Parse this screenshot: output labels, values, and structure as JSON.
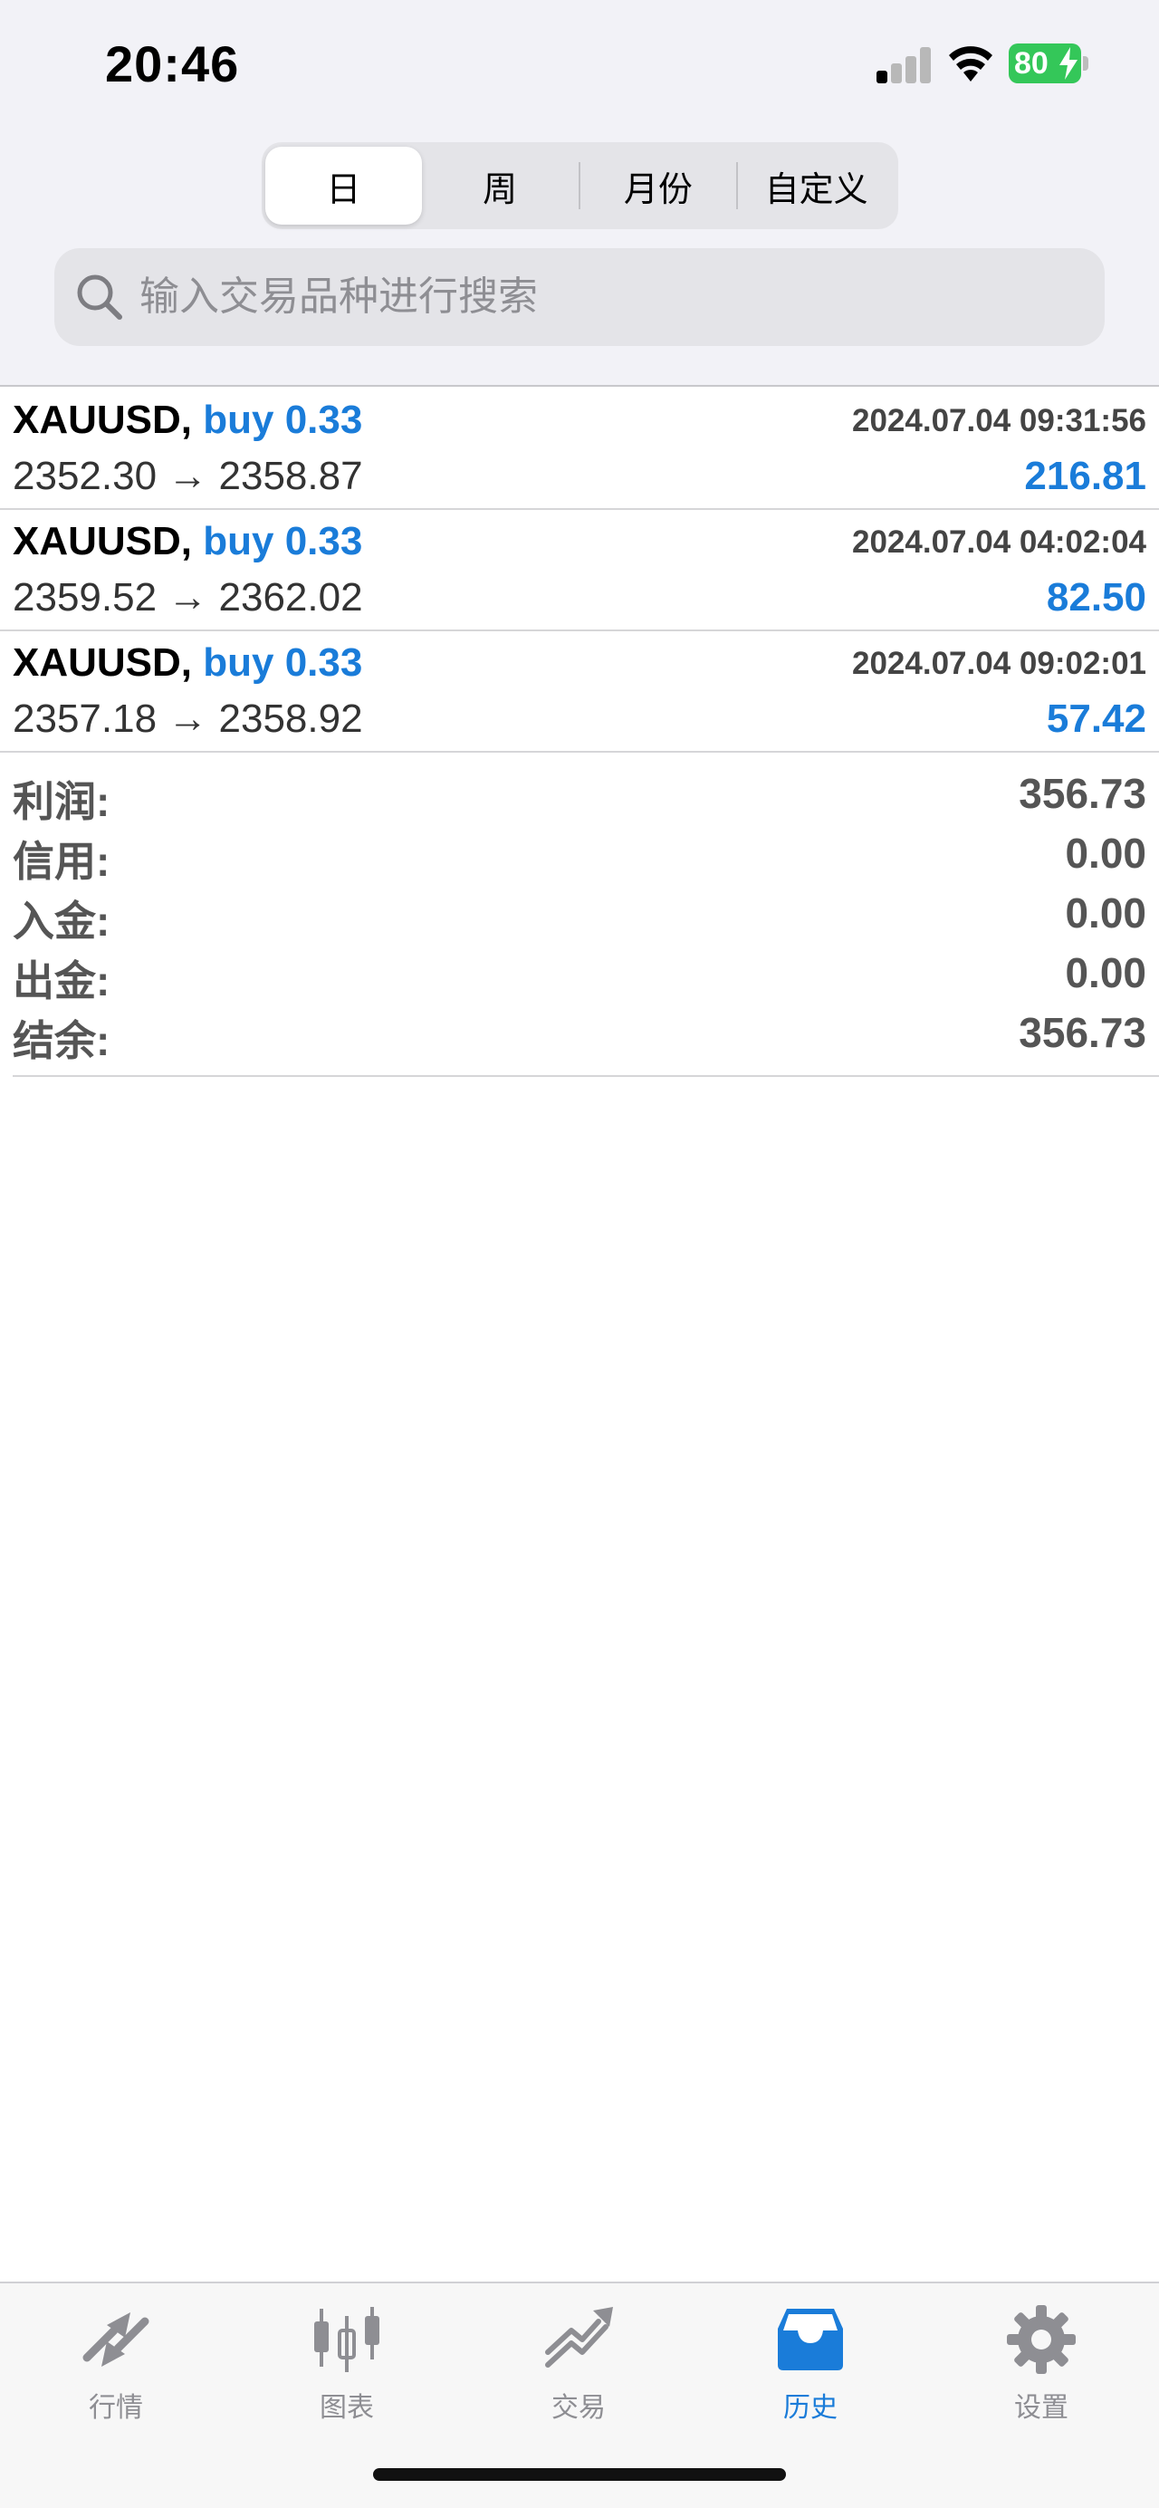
{
  "status": {
    "time": "20:46",
    "battery": "80"
  },
  "segment": {
    "items": [
      "日",
      "周",
      "月份",
      "自定义"
    ],
    "selected": "日"
  },
  "search": {
    "placeholder": "输入交易品种进行搜索"
  },
  "trades": [
    {
      "symbol": "XAUUSD,",
      "side": "buy 0.33",
      "time": "2024.07.04 09:31:56",
      "prices": "2352.30 → 2358.87",
      "profit": "216.81"
    },
    {
      "symbol": "XAUUSD,",
      "side": "buy 0.33",
      "time": "2024.07.04 04:02:04",
      "prices": "2359.52 → 2362.02",
      "profit": "82.50"
    },
    {
      "symbol": "XAUUSD,",
      "side": "buy 0.33",
      "time": "2024.07.04 09:02:01",
      "prices": "2357.18 → 2358.92",
      "profit": "57.42"
    }
  ],
  "summary": [
    {
      "label": "利润:",
      "value": "356.73"
    },
    {
      "label": "信用:",
      "value": "0.00"
    },
    {
      "label": "入金:",
      "value": "0.00"
    },
    {
      "label": "出金:",
      "value": "0.00"
    },
    {
      "label": "结余:",
      "value": "356.73"
    }
  ],
  "tabbar": {
    "items": [
      {
        "label": "行情",
        "icon": "quotes-icon"
      },
      {
        "label": "图表",
        "icon": "chart-icon"
      },
      {
        "label": "交易",
        "icon": "trade-icon"
      },
      {
        "label": "历史",
        "icon": "history-icon"
      },
      {
        "label": "设置",
        "icon": "settings-icon"
      }
    ],
    "selected": "历史"
  },
  "colors": {
    "accent": "#1a7cd9",
    "battery": "#34c759",
    "background_top": "#f2f2f7"
  }
}
